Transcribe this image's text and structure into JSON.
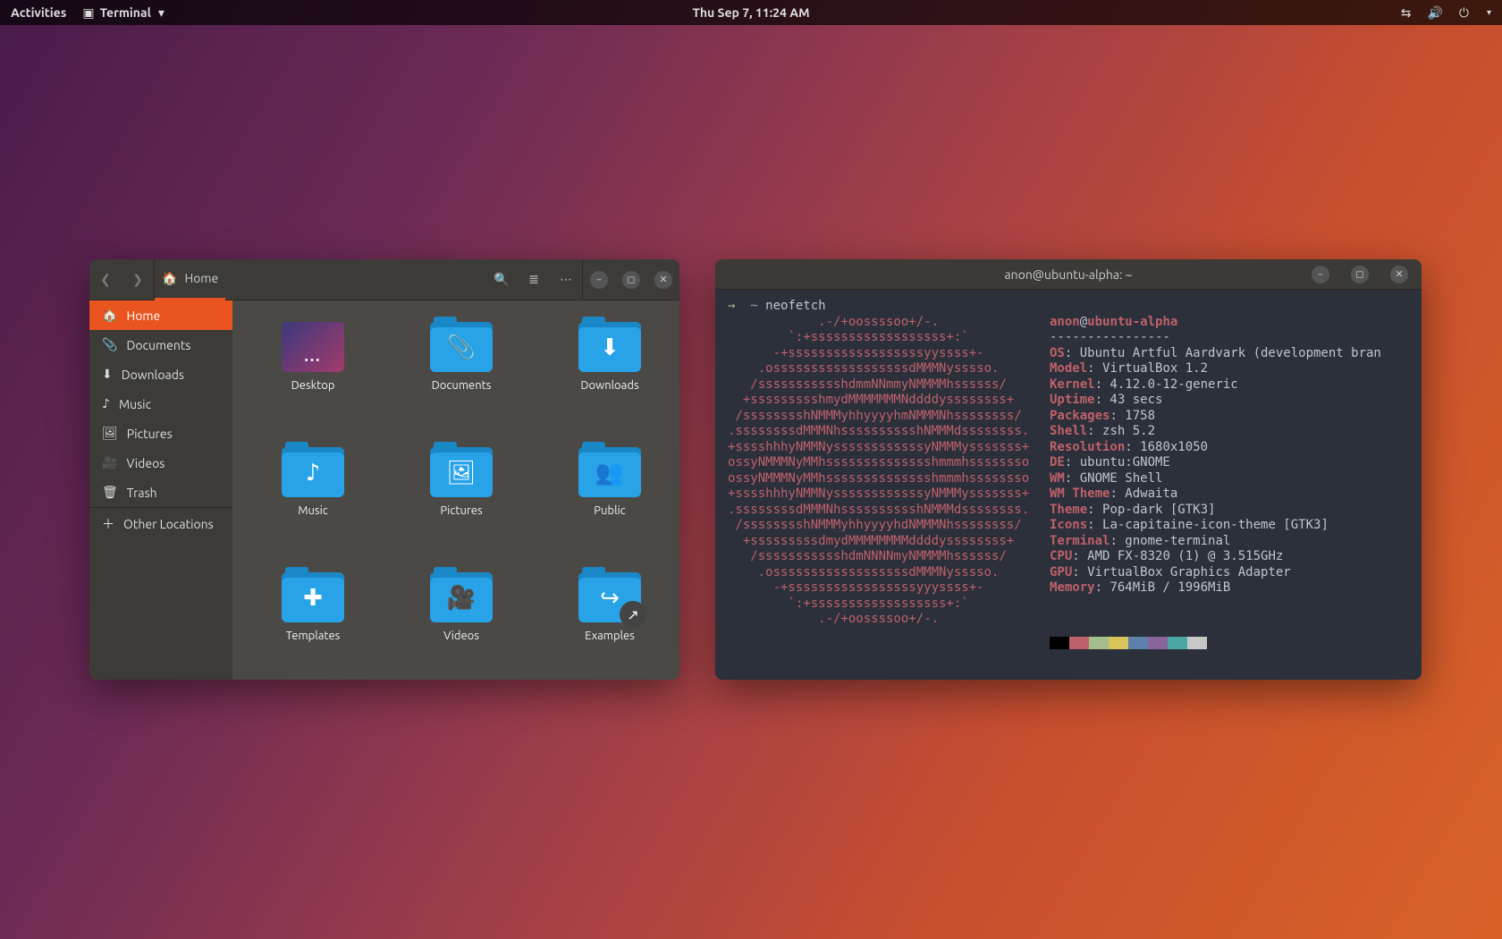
{
  "topbar": {
    "activities": "Activities",
    "app": "Terminal",
    "datetime": "Thu Sep  7, 11:24 AM"
  },
  "nautilus": {
    "path_label": "Home",
    "sidebar": [
      {
        "icon": "🏠",
        "label": "Home"
      },
      {
        "icon": "📎",
        "label": "Documents"
      },
      {
        "icon": "⬇",
        "label": "Downloads"
      },
      {
        "icon": "♪",
        "label": "Music"
      },
      {
        "icon": "🖼",
        "label": "Pictures"
      },
      {
        "icon": "🎥",
        "label": "Videos"
      },
      {
        "icon": "🗑",
        "label": "Trash"
      }
    ],
    "other_locations": "Other Locations",
    "items": [
      {
        "label": "Desktop",
        "type": "desktop"
      },
      {
        "label": "Documents",
        "type": "folder",
        "glyph": "📎"
      },
      {
        "label": "Downloads",
        "type": "folder",
        "glyph": "⬇"
      },
      {
        "label": "Music",
        "type": "folder",
        "glyph": "♪"
      },
      {
        "label": "Pictures",
        "type": "folder",
        "glyph": "🖼"
      },
      {
        "label": "Public",
        "type": "folder",
        "glyph": "👥"
      },
      {
        "label": "Templates",
        "type": "folder",
        "glyph": "✚"
      },
      {
        "label": "Videos",
        "type": "folder",
        "glyph": "🎥"
      },
      {
        "label": "Examples",
        "type": "folder",
        "glyph": "↪",
        "share": true
      },
      {
        "label": "",
        "type": "doc"
      },
      {
        "label": "",
        "type": "doc"
      }
    ]
  },
  "terminal": {
    "title": "anon@ubuntu-alpha: ~",
    "prompt_path": "~",
    "command": "neofetch",
    "ascii": [
      "            .-/+oossssoo+/-.",
      "        `:+ssssssssssssssssss+:`",
      "      -+ssssssssssssssssssyyssss+-",
      "    .ossssssssssssssssssdMMMNysssso.",
      "   /ssssssssssshdmmNNmmyNMMMMhssssss/",
      "  +ssssssssshmydMMMMMMMNddddyssssssss+",
      " /sssssssshNMMMyhhyyyyhmNMMMNhssssssss/",
      ".ssssssssdMMMNhsssssssssshNMMMdssssssss.",
      "+sssshhhyNMMNyssssssssssssyNMMMysssssss+",
      "ossyNMMMNyMMhsssssssssssssshmmmhssssssso",
      "ossyNMMMNyMMhsssssssssssssshmmmhssssssso",
      "+sssshhhyNMMNyssssssssssssyNMMMysssssss+",
      ".ssssssssdMMMNhsssssssssshNMMMdssssssss.",
      " /sssssssshNMMMyhhyyyyhdNMMMNhssssssss/",
      "  +sssssssssdmydMMMMMMMMddddyssssssss+",
      "   /ssssssssssshdmNNNNmyNMMMMhssssss/",
      "    .ossssssssssssssssssdMMMNysssso.",
      "      -+sssssssssssssssssyyyssss+-",
      "        `:+ssssssssssssssssss+:`",
      "            .-/+oossssoo+/-."
    ],
    "user": "anon",
    "host": "ubuntu-alpha",
    "rule": "----------------",
    "info": [
      {
        "k": "OS",
        "v": "Ubuntu Artful Aardvark (development bran"
      },
      {
        "k": "Model",
        "v": "VirtualBox 1.2"
      },
      {
        "k": "Kernel",
        "v": "4.12.0-12-generic"
      },
      {
        "k": "Uptime",
        "v": "43 secs"
      },
      {
        "k": "Packages",
        "v": "1758"
      },
      {
        "k": "Shell",
        "v": "zsh 5.2"
      },
      {
        "k": "Resolution",
        "v": "1680x1050"
      },
      {
        "k": "DE",
        "v": "ubuntu:GNOME"
      },
      {
        "k": "WM",
        "v": "GNOME Shell"
      },
      {
        "k": "WM Theme",
        "v": "Adwaita"
      },
      {
        "k": "Theme",
        "v": "Pop-dark [GTK3]"
      },
      {
        "k": "Icons",
        "v": "La-capitaine-icon-theme [GTK3]"
      },
      {
        "k": "Terminal",
        "v": "gnome-terminal"
      },
      {
        "k": "CPU",
        "v": "AMD FX-8320 (1) @ 3.515GHz"
      },
      {
        "k": "GPU",
        "v": "VirtualBox Graphics Adapter"
      },
      {
        "k": "Memory",
        "v": "764MiB / 1996MiB"
      }
    ]
  }
}
